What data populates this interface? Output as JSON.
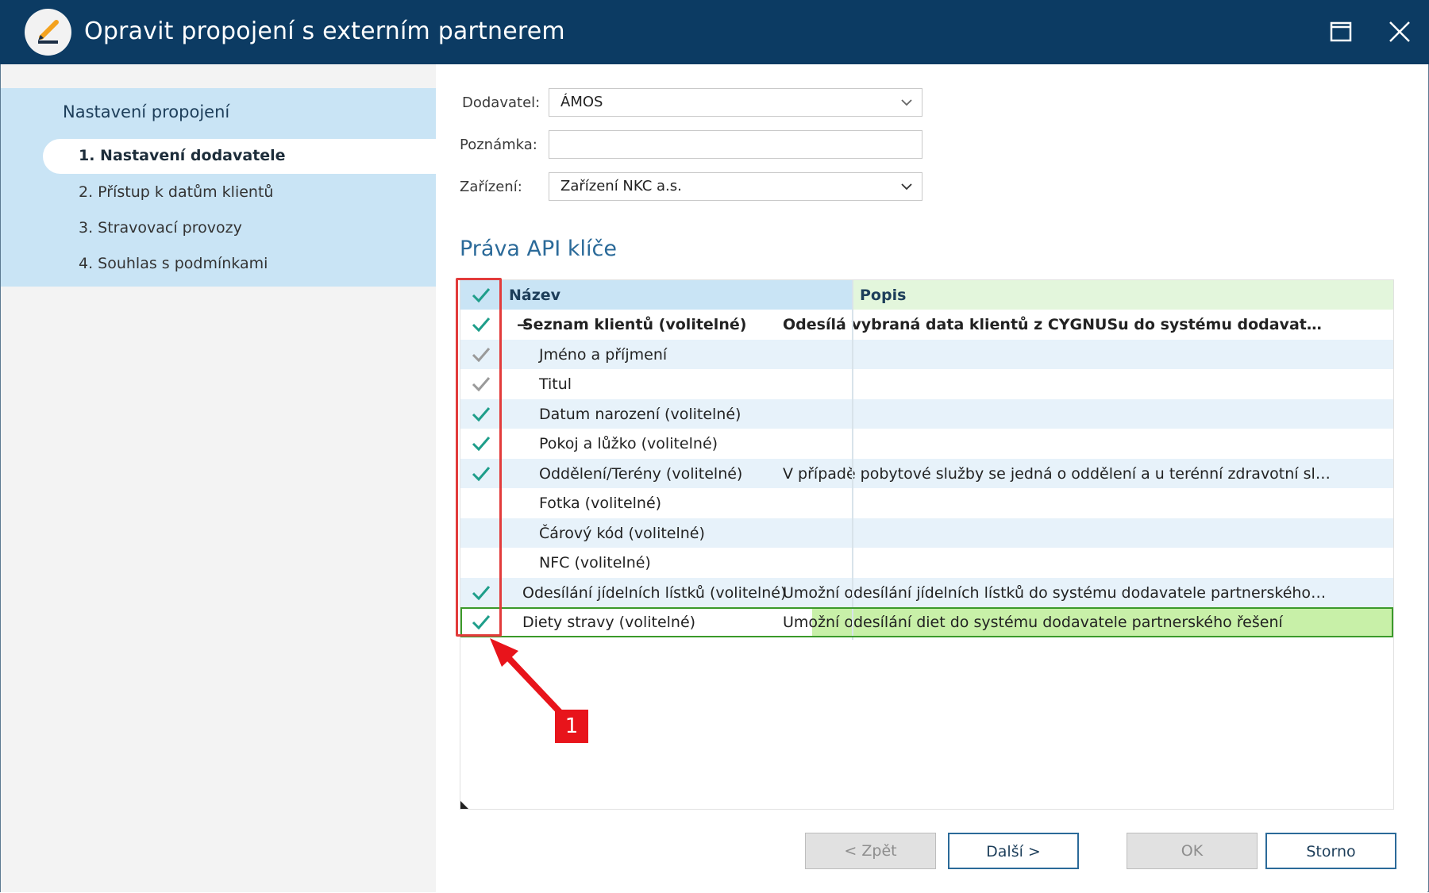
{
  "window": {
    "title": "Opravit propojení s externím partnerem"
  },
  "sidebar": {
    "heading": "Nastavení propojení",
    "items": [
      {
        "label": "1. Nastavení dodavatele",
        "active": true
      },
      {
        "label": "2. Přístup k datům klientů"
      },
      {
        "label": "3. Stravovací provozy"
      },
      {
        "label": "4. Souhlas s podmínkami"
      }
    ]
  },
  "form": {
    "supplier_label": "Dodavatel:",
    "supplier_value": "ÁMOS",
    "note_label": "Poznámka:",
    "note_value": "",
    "device_label": "Zařízení:",
    "device_value": "Zařízení NKC a.s."
  },
  "section": {
    "title": "Práva API klíče"
  },
  "grid": {
    "columns": {
      "name": "Název",
      "description": "Popis"
    },
    "rows": [
      {
        "name": "Seznam klientů (volitelné)",
        "description": "Odesílá vybraná data klientů z CYGNUSu do systému dodavatele par...",
        "check": "on",
        "level": 0,
        "bold": true,
        "expander": "−"
      },
      {
        "name": "Jméno a příjmení",
        "description": "",
        "check": "gray",
        "level": 1
      },
      {
        "name": "Titul",
        "description": "",
        "check": "gray",
        "level": 1
      },
      {
        "name": "Datum narození (volitelné)",
        "description": "",
        "check": "on",
        "level": 1
      },
      {
        "name": "Pokoj a lůžko (volitelné)",
        "description": "",
        "check": "on",
        "level": 1
      },
      {
        "name": "Oddělení/Terény (volitelné)",
        "description": "V případě pobytové služby se jedná o oddělení a u terénní zdravotní služby...",
        "check": "on",
        "level": 1
      },
      {
        "name": "Fotka (volitelné)",
        "description": "",
        "check": "off",
        "level": 1
      },
      {
        "name": "Čárový kód (volitelné)",
        "description": "",
        "check": "off",
        "level": 1
      },
      {
        "name": "NFC (volitelné)",
        "description": "",
        "check": "off",
        "level": 1
      },
      {
        "name": "Odesílání jídelních lístků (volitelné)",
        "description": "Umožní odesílání jídelních lístků do systému dodavatele partnerského řešení",
        "check": "on",
        "level": 0
      },
      {
        "name": "Diety stravy (volitelné)",
        "description": "Umožní odesílání diet do systému dodavatele partnerského řešení",
        "check": "on",
        "level": 0,
        "selected": true
      }
    ]
  },
  "annotation": {
    "callout_number": "1"
  },
  "buttons": {
    "back": "< Zpět",
    "next": "Další >",
    "ok": "OK",
    "cancel": "Storno"
  },
  "colors": {
    "titlebar": "#0c3b63",
    "accent": "#2b6a99",
    "check": "#1e9e8a",
    "check_gray": "#9a9a9a",
    "annotation": "#e23b3b"
  }
}
